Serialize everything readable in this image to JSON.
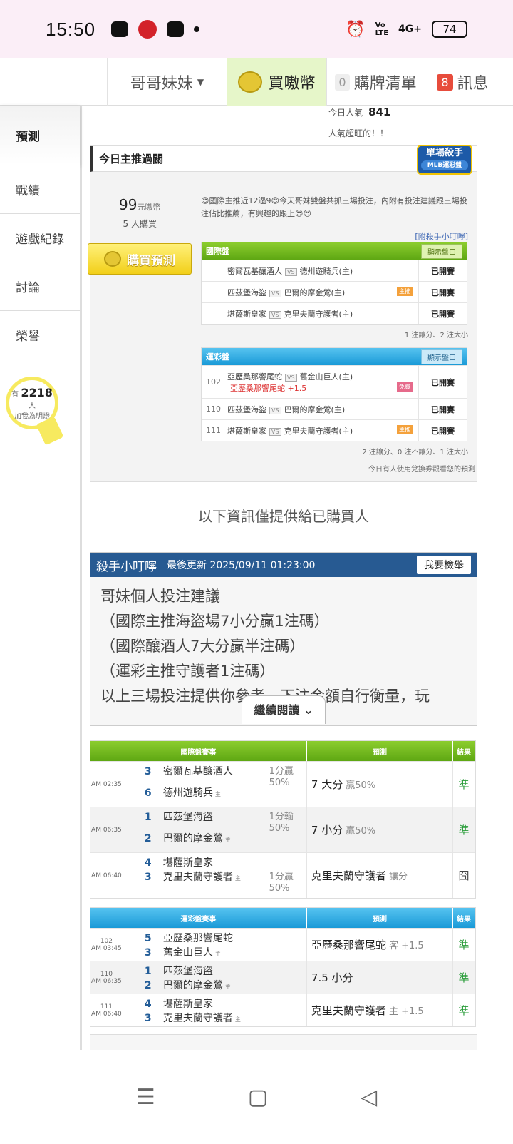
{
  "status_bar": {
    "time": "15:50",
    "battery": "74",
    "net": "4G+"
  },
  "top_nav": {
    "brand": "哥哥妹妹",
    "buy_coin": "買嗷幣",
    "cart_count": "0",
    "cart_label": "購牌清單",
    "msg_count": "8",
    "msg_label": "訊息"
  },
  "sidebar": {
    "items": [
      {
        "label": "預測"
      },
      {
        "label": "戰績"
      },
      {
        "label": "遊戲紀錄"
      },
      {
        "label": "討論"
      },
      {
        "label": "榮譽"
      }
    ],
    "fans_prefix": "有",
    "fans_count": "2218",
    "fans_suffix": "人",
    "fans_note": "加我為明燈"
  },
  "popularity": {
    "label": "今日人氣",
    "value": "841",
    "note": "人氣超旺的！！"
  },
  "today": {
    "title": "今日主推過關",
    "killer_badge": "單場殺手",
    "killer_sub": "MLB運彩盤",
    "price": "99",
    "price_unit": "元嗷幣",
    "buyers": "5",
    "buyers_unit": "人購買",
    "buy_button": "購買預測",
    "desc": "😍國際主推近12過9😍今天哥妹雙盤共抓三場投注，內附有投注建議跟三場投注佔比推薦，有興趣的跟上😍😍",
    "ann_link": "[附殺手小叮嚀]",
    "intl": {
      "header": "國際盤",
      "toggle": "顯示盤口",
      "rows": [
        {
          "home": "密爾瓦基釀酒人",
          "away": "德州遊騎兵(主)",
          "status": "已開賽",
          "tag": ""
        },
        {
          "home": "匹茲堡海盜",
          "away": "巴爾的摩金鶯(主)",
          "status": "已開賽",
          "tag": "主推"
        },
        {
          "home": "堪薩斯皇家",
          "away": "克里夫蘭守護者(主)",
          "status": "已開賽",
          "tag": ""
        }
      ],
      "note": "1 注讓分、2 注大小"
    },
    "sports": {
      "header": "運彩盤",
      "toggle": "顯示盤口",
      "rows": [
        {
          "no": "102",
          "home": "亞歷桑那響尾蛇",
          "away": "舊金山巨人(主)",
          "pick": "亞歷桑那響尾蛇 +1.5",
          "status": "已開賽",
          "tag": "免費"
        },
        {
          "no": "110",
          "home": "匹茲堡海盜",
          "away": "巴爾的摩金鶯(主)",
          "status": "已開賽",
          "tag": ""
        },
        {
          "no": "111",
          "home": "堪薩斯皇家",
          "away": "克里夫蘭守護者(主)",
          "status": "已開賽",
          "tag": "主推"
        }
      ],
      "note": "2 注讓分、0 注不讓分、1 注大小"
    },
    "coupon_note": "今日有人使用兌換券觀看您的預測"
  },
  "notice": "以下資訊僅提供給已購買人",
  "tip": {
    "title": "殺手小叮嚀",
    "updated": "最後更新 2025/09/11 01:23:00",
    "report": "我要檢舉",
    "lines": [
      "哥妹個人投注建議",
      "（國際主推海盜場7小分贏1注碼）",
      "（國際釀酒人7大分贏半注碼）",
      "（運彩主推守護者1注碼）",
      "以上三場投注提供你參考，下注金額自行衡量，玩"
    ],
    "more": "繼續閱讀"
  },
  "intl_results": {
    "h1": "國際盤賽事",
    "h2": "預測",
    "h3": "結果",
    "rows": [
      {
        "time": "AM 02:35",
        "s1": "3",
        "t1": "密爾瓦基釀酒人",
        "s2": "6",
        "t2": "德州遊騎兵",
        "hcp": "1分贏",
        "hcp2": "50%",
        "pred": "7 大分",
        "pg": "贏50%",
        "res": "準"
      },
      {
        "time": "AM 06:35",
        "s1": "1",
        "t1": "匹茲堡海盜",
        "s2": "2",
        "t2": "巴爾的摩金鶯",
        "hcp": "1分輸",
        "hcp2": "50%",
        "pred": "7 小分",
        "pg": "贏50%",
        "res": "準"
      },
      {
        "time": "AM 06:40",
        "s1": "4",
        "t1": "堪薩斯皇家",
        "s2": "3",
        "t2": "克里夫蘭守護者",
        "hcp": "1分贏",
        "hcp2": "50%",
        "pred": "克里夫蘭守護者",
        "pg": "讓分",
        "res": "囧"
      }
    ]
  },
  "sport_results": {
    "h1": "運彩盤賽事",
    "h2": "預測",
    "h3": "結果",
    "rows": [
      {
        "no": "102",
        "time": "AM 03:45",
        "s1": "5",
        "t1": "亞歷桑那響尾蛇",
        "s2": "3",
        "t2": "舊金山巨人",
        "pred": "亞歷桑那響尾蛇",
        "pg": "客 +1.5",
        "res": "準"
      },
      {
        "no": "110",
        "time": "AM 06:35",
        "s1": "1",
        "t1": "匹茲堡海盜",
        "s2": "2",
        "t2": "巴爾的摩金鶯",
        "pred": "7.5 小分",
        "pg": "",
        "res": "準"
      },
      {
        "no": "111",
        "time": "AM 06:40",
        "s1": "4",
        "t1": "堪薩斯皇家",
        "s2": "3",
        "t2": "克里夫蘭守護者",
        "pred": "克里夫蘭守護者",
        "pg": "主 +1.5",
        "res": "準"
      }
    ]
  },
  "home_mark": "主",
  "colors": {
    "green": "#5ea713",
    "blue": "#1a9ad7",
    "navy": "#275a92",
    "win": "#2a9d3a"
  }
}
